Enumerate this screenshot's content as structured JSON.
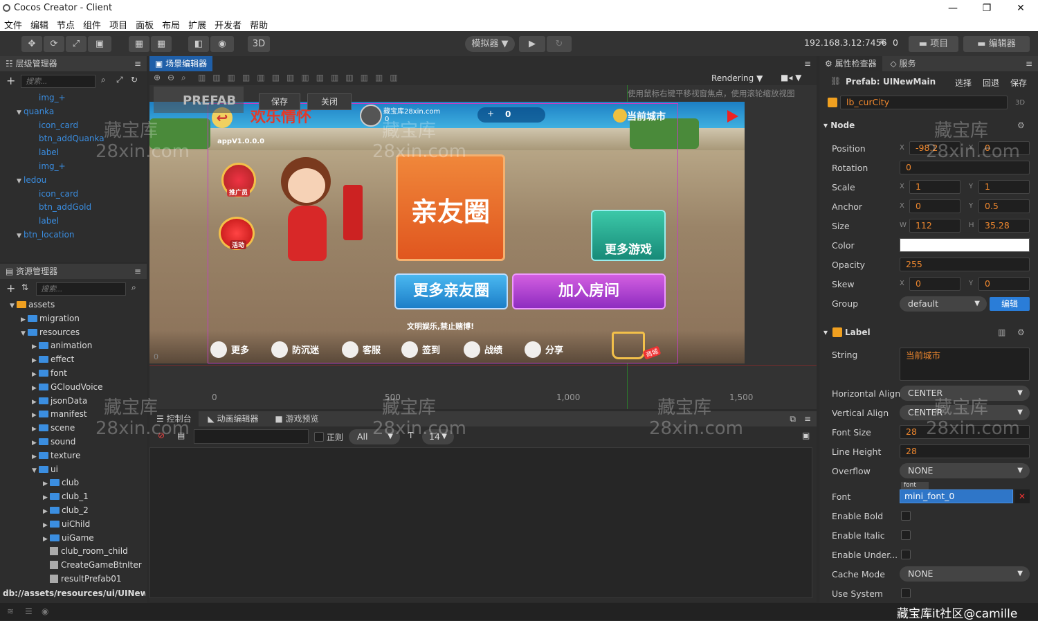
{
  "window": {
    "title": "Cocos Creator - Client"
  },
  "menu": [
    "文件",
    "编辑",
    "节点",
    "组件",
    "项目",
    "面板",
    "布局",
    "扩展",
    "开发者",
    "帮助"
  ],
  "toolbar": {
    "btn_3d": "3D",
    "simulator": "模拟器 ▼",
    "ip": "192.168.3.12:7456",
    "count": "0",
    "project": "项目",
    "editor": "编辑器"
  },
  "hierarchy": {
    "title": "层级管理器",
    "search_placeholder": "搜索...",
    "items": [
      {
        "label": "img_+",
        "indent": 3
      },
      {
        "label": "quanka",
        "indent": 2,
        "arrow": "▼"
      },
      {
        "label": "icon_card",
        "indent": 3
      },
      {
        "label": "btn_addQuanka",
        "indent": 3
      },
      {
        "label": "label",
        "indent": 3
      },
      {
        "label": "img_+",
        "indent": 3
      },
      {
        "label": "ledou",
        "indent": 2,
        "arrow": "▼"
      },
      {
        "label": "icon_card",
        "indent": 3
      },
      {
        "label": "btn_addGold",
        "indent": 3
      },
      {
        "label": "label",
        "indent": 3
      },
      {
        "label": "btn_location",
        "indent": 2,
        "arrow": "▼"
      }
    ]
  },
  "assets": {
    "title": "资源管理器",
    "search_placeholder": "搜索...",
    "items": [
      {
        "label": "assets",
        "indent": 0,
        "arrow": "▼",
        "type": "root"
      },
      {
        "label": "migration",
        "indent": 1,
        "arrow": "▶",
        "type": "folder"
      },
      {
        "label": "resources",
        "indent": 1,
        "arrow": "▼",
        "type": "folder"
      },
      {
        "label": "animation",
        "indent": 2,
        "arrow": "▶",
        "type": "folder"
      },
      {
        "label": "effect",
        "indent": 2,
        "arrow": "▶",
        "type": "folder"
      },
      {
        "label": "font",
        "indent": 2,
        "arrow": "▶",
        "type": "folder"
      },
      {
        "label": "GCloudVoice",
        "indent": 2,
        "arrow": "▶",
        "type": "folder"
      },
      {
        "label": "jsonData",
        "indent": 2,
        "arrow": "▶",
        "type": "folder"
      },
      {
        "label": "manifest",
        "indent": 2,
        "arrow": "▶",
        "type": "folder"
      },
      {
        "label": "scene",
        "indent": 2,
        "arrow": "▶",
        "type": "folder"
      },
      {
        "label": "sound",
        "indent": 2,
        "arrow": "▶",
        "type": "folder"
      },
      {
        "label": "texture",
        "indent": 2,
        "arrow": "▶",
        "type": "folder"
      },
      {
        "label": "ui",
        "indent": 2,
        "arrow": "▼",
        "type": "folder"
      },
      {
        "label": "club",
        "indent": 3,
        "arrow": "▶",
        "type": "folder"
      },
      {
        "label": "club_1",
        "indent": 3,
        "arrow": "▶",
        "type": "folder"
      },
      {
        "label": "club_2",
        "indent": 3,
        "arrow": "▶",
        "type": "folder"
      },
      {
        "label": "uiChild",
        "indent": 3,
        "arrow": "▶",
        "type": "folder"
      },
      {
        "label": "uiGame",
        "indent": 3,
        "arrow": "▶",
        "type": "folder"
      },
      {
        "label": "club_room_child",
        "indent": 3,
        "arrow": "",
        "type": "prefab"
      },
      {
        "label": "CreateGameBtnIter",
        "indent": 3,
        "arrow": "",
        "type": "prefab"
      },
      {
        "label": "resultPrefab01",
        "indent": 3,
        "arrow": "",
        "type": "prefab"
      }
    ],
    "status_path": "db://assets/resources/ui/UINew..."
  },
  "scene": {
    "tab": "场景编辑器",
    "rendering": "Rendering",
    "hint": "使用鼠标右键平移视窗焦点，使用滚轮缩放视图",
    "prefab_mark": "PREFAB",
    "save": "保存",
    "close": "关闭",
    "ruler_x": [
      "0",
      "500",
      "1,000",
      "1,500"
    ],
    "ruler_y0": "0",
    "game": {
      "logo": "欢乐情怀",
      "version": "appV1.0.0.0",
      "player": "藏宝库28xin.com",
      "player_sub": "0",
      "coins": "0",
      "city": "当前城市",
      "promoter": "推广员",
      "activity": "活动",
      "big_btn": "亲友圈",
      "more_games": "更多游戏",
      "more_circle": "更多亲友圈",
      "join_room": "加入房间",
      "notice": "文明娱乐,禁止赌博!",
      "bottom": [
        "更多",
        "防沉迷",
        "客服",
        "签到",
        "战绩",
        "分享"
      ],
      "shop": "商城"
    }
  },
  "console": {
    "tabs": [
      "控制台",
      "动画编辑器",
      "游戏预览"
    ],
    "regex": "正则",
    "filter": "All",
    "font_size": "14"
  },
  "inspector": {
    "tabs": [
      "属性检查器",
      "服务"
    ],
    "prefab_label": "Prefab:",
    "prefab_name": "UINewMain",
    "select": "选择",
    "revert": "回退",
    "save": "保存",
    "node_name": "lb_curCity",
    "badge_3d": "3D",
    "node_section": "Node",
    "position": {
      "label": "Position",
      "x": "-98.2",
      "y": "0"
    },
    "rotation": {
      "label": "Rotation",
      "value": "0"
    },
    "scale": {
      "label": "Scale",
      "x": "1",
      "y": "1"
    },
    "anchor": {
      "label": "Anchor",
      "x": "0",
      "y": "0.5"
    },
    "size": {
      "label": "Size",
      "w": "112",
      "h": "35.28"
    },
    "color": {
      "label": "Color",
      "value": "#ffffff"
    },
    "opacity": {
      "label": "Opacity",
      "value": "255"
    },
    "skew": {
      "label": "Skew",
      "x": "0",
      "y": "0"
    },
    "group": {
      "label": "Group",
      "value": "default",
      "edit": "编辑"
    },
    "label_section": "Label",
    "string": {
      "label": "String",
      "value": "当前城市"
    },
    "halign": {
      "label": "Horizontal Align",
      "value": "CENTER"
    },
    "valign": {
      "label": "Vertical Align",
      "value": "CENTER"
    },
    "font_size": {
      "label": "Font Size",
      "value": "28"
    },
    "line_height": {
      "label": "Line Height",
      "value": "28"
    },
    "overflow": {
      "label": "Overflow",
      "value": "NONE"
    },
    "font": {
      "label": "Font",
      "tag": "font",
      "value": "mini_font_0"
    },
    "bold": {
      "label": "Enable Bold"
    },
    "italic": {
      "label": "Enable Italic"
    },
    "underline": {
      "label": "Enable Under..."
    },
    "cache_mode": {
      "label": "Cache Mode",
      "value": "NONE"
    },
    "use_system": {
      "label": "Use System"
    }
  },
  "watermark": {
    "cn": "藏宝库",
    "en": "28xin.com",
    "footer": "藏宝库it社区@camille"
  },
  "axis_labels": {
    "x": "X",
    "y": "Y",
    "w": "W",
    "h": "H"
  }
}
